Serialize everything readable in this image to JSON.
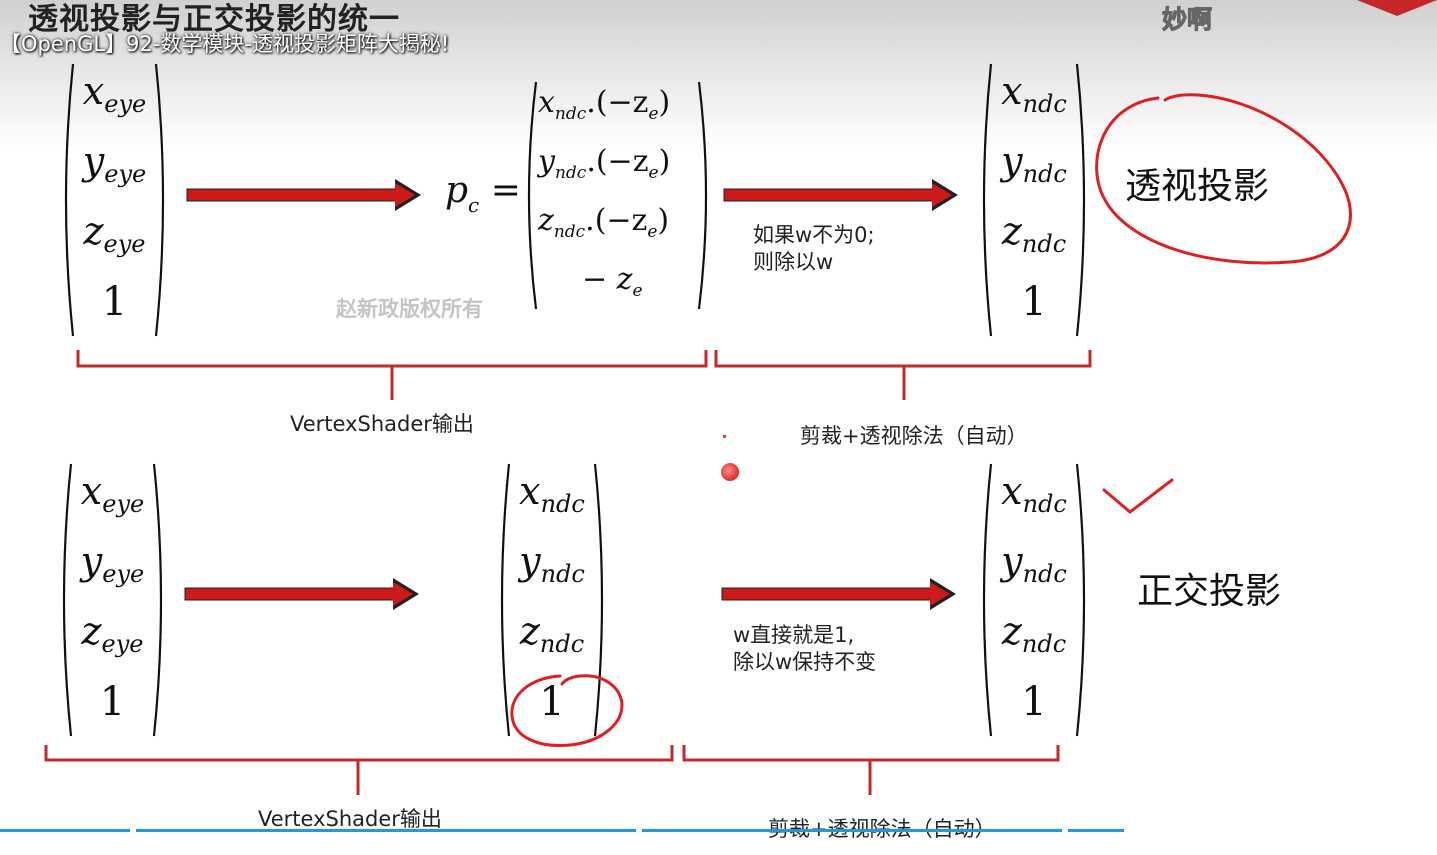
{
  "slide": {
    "title": "透视投影与正交投影的统一",
    "watermark": "赵新政版权所有"
  },
  "video": {
    "title": "【OpenGL】92-数学模块-透视投影矩阵大揭秘!",
    "danmaku": "妙啊"
  },
  "top_row": {
    "input_matrix": [
      {
        "v": "x",
        "s": "eye"
      },
      {
        "v": "y",
        "s": "eye"
      },
      {
        "v": "z",
        "s": "eye"
      },
      {
        "n": "1"
      }
    ],
    "pc_label": {
      "v": "p",
      "s": "c",
      "eq": "="
    },
    "pc_matrix": [
      {
        "v": "x",
        "s": "ndc",
        "rest": ".(−z",
        "sub2": "e",
        "close": ")"
      },
      {
        "v": "y",
        "s": "ndc",
        "rest": ".(−z",
        "sub2": "e",
        "close": ")"
      },
      {
        "v": "z",
        "s": "ndc",
        "rest": ".(−z",
        "sub2": "e",
        "close": ")"
      },
      {
        "v": "− z",
        "s": "e"
      }
    ],
    "note_line1": "如果w不为0;",
    "note_line2": "则除以w",
    "output_matrix": [
      {
        "v": "x",
        "s": "ndc"
      },
      {
        "v": "y",
        "s": "ndc"
      },
      {
        "v": "z",
        "s": "ndc"
      },
      {
        "n": "1"
      }
    ],
    "label": "透视投影",
    "brace_left": "VertexShader输出",
    "brace_right": "剪裁+透视除法（自动）"
  },
  "bottom_row": {
    "input_matrix": [
      {
        "v": "x",
        "s": "eye"
      },
      {
        "v": "y",
        "s": "eye"
      },
      {
        "v": "z",
        "s": "eye"
      },
      {
        "n": "1"
      }
    ],
    "mid_matrix": [
      {
        "v": "x",
        "s": "ndc"
      },
      {
        "v": "y",
        "s": "ndc"
      },
      {
        "v": "z",
        "s": "ndc"
      },
      {
        "n": "1"
      }
    ],
    "note_line1": "w直接就是1,",
    "note_line2": "除以w保持不变",
    "output_matrix": [
      {
        "v": "x",
        "s": "ndc"
      },
      {
        "v": "y",
        "s": "ndc"
      },
      {
        "v": "z",
        "s": "ndc"
      },
      {
        "n": "1"
      }
    ],
    "label": "正交投影",
    "brace_left": "VertexShader输出",
    "brace_right": "剪裁+透视除法（自动）"
  },
  "colors": {
    "arrow_red": "#cc1a1a",
    "annotation_red": "#e02020",
    "brace_red": "#c62828",
    "progress_blue": "#1e9be0"
  }
}
